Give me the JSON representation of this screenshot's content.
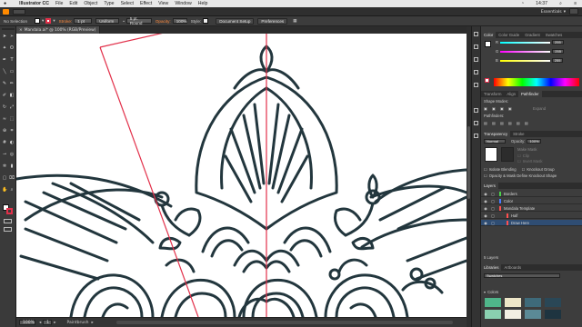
{
  "menubar": {
    "app_name": "Illustrator CC",
    "items": [
      "File",
      "Edit",
      "Object",
      "Type",
      "Select",
      "Effect",
      "View",
      "Window",
      "Help"
    ],
    "clock": "14:37"
  },
  "appbar": {
    "workspace": "Essentials"
  },
  "controlbar": {
    "selection_label": "No Selection",
    "stroke_label": "Stroke:",
    "stroke_value": "1 pt",
    "profile_value": "Uniform",
    "brush_value": "5 pt. Round",
    "opacity_label": "Opacity:",
    "opacity_value": "100%",
    "style_label": "Style:",
    "document_setup_button": "Document Setup",
    "preferences_button": "Preferences"
  },
  "document": {
    "tab_title": "Mandala.ai* @ 100% (RGB/Preview)"
  },
  "statusbar": {
    "zoom": "100%",
    "page": "1",
    "tool": "Paintbrush"
  },
  "color_panel": {
    "tabs": [
      "Color",
      "Color Guide",
      "Gradient",
      "Swatches"
    ],
    "r_label": "R",
    "r_value": "255",
    "g_label": "G",
    "g_value": "255",
    "b_label": "B",
    "b_value": "255"
  },
  "transform_panel": {
    "tabs": [
      "Transform",
      "Align",
      "Pathfinder"
    ],
    "shape_modes_label": "Shape Modes:",
    "pathfinders_label": "Pathfinders:",
    "expand_button": "Expand"
  },
  "transparency_panel": {
    "tabs": [
      "Transparency",
      "Stroke"
    ],
    "blend_mode": "Normal",
    "opacity_label": "Opacity:",
    "opacity_value": "100%",
    "make_mask_button": "Make Mask",
    "clip_label": "Clip",
    "invert_mask_label": "Invert Mask",
    "isolate_blending_label": "Isolate Blending",
    "knockout_group_label": "Knockout Group",
    "opacity_mask_label": "Opacity & Mask Define Knockout Shape"
  },
  "layers_panel": {
    "tab": "Layers",
    "rows": [
      {
        "name": "Borders",
        "color": "#4bd14b"
      },
      {
        "name": "Color",
        "color": "#4a7cff"
      },
      {
        "name": "Mandala Template",
        "color": "#ff4f4f"
      },
      {
        "name": "Half",
        "color": "#ff4f4f"
      },
      {
        "name": "Draw Here",
        "color": "#ff4f4f"
      }
    ],
    "footer": "5 Layers"
  },
  "libraries_panel": {
    "tabs": [
      "Libraries",
      "Artboards"
    ],
    "library_name": "Swatches",
    "colors_label": "Colors",
    "swatches": [
      "#4fb58a",
      "#ede6c8",
      "#3e6a7a",
      "#2a4756",
      "#8ad0b0",
      "#f2efe3",
      "#5b8a96",
      "#1e3440"
    ]
  },
  "colors": {
    "accent_orange": "#ff8a3d",
    "line_art": "#22363d",
    "guide_red": "#e2304a"
  },
  "tools": [
    "selection-tool",
    "direct-selection-tool",
    "magic-wand-tool",
    "lasso-tool",
    "pen-tool",
    "type-tool",
    "line-tool",
    "rectangle-tool",
    "paintbrush-tool",
    "pencil-tool",
    "blob-brush-tool",
    "eraser-tool",
    "rotate-tool",
    "scale-tool",
    "width-tool",
    "free-transform-tool",
    "shape-builder-tool",
    "perspective-grid-tool",
    "mesh-tool",
    "gradient-tool",
    "eyedropper-tool",
    "blend-tool",
    "symbol-sprayer-tool",
    "column-graph-tool",
    "artboard-tool",
    "slice-tool",
    "hand-tool",
    "zoom-tool"
  ]
}
